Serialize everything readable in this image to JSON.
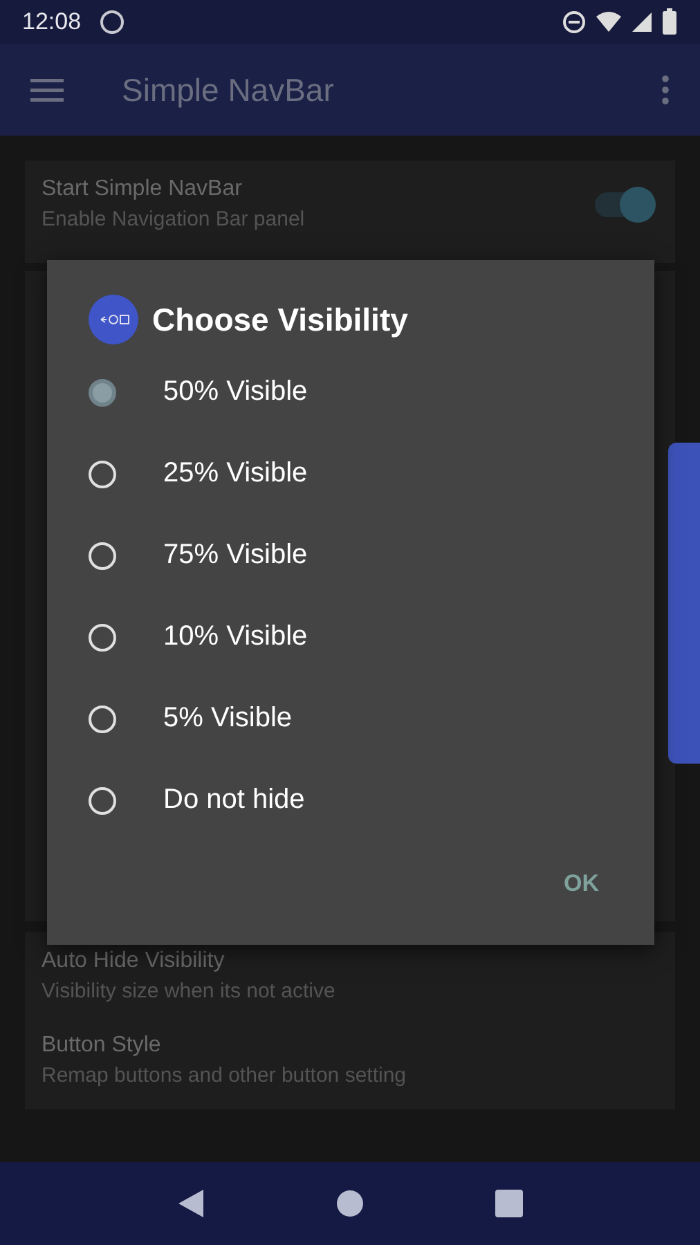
{
  "status_bar": {
    "time": "12:08"
  },
  "app_bar": {
    "title": "Simple NavBar"
  },
  "settings": [
    {
      "title": "Start Simple NavBar",
      "summary": "Enable Navigation Bar panel",
      "kind": "switch",
      "on": true
    },
    {
      "title": "Auto Hide Visibility",
      "summary": "Visibility size when its not active",
      "kind": "plain"
    },
    {
      "title": "Button Style",
      "summary": "Remap buttons and other button setting",
      "kind": "plain"
    }
  ],
  "dialog": {
    "title": "Choose Visibility",
    "options": [
      {
        "label": "50% Visible",
        "selected": true
      },
      {
        "label": "25% Visible",
        "selected": false
      },
      {
        "label": "75% Visible",
        "selected": false
      },
      {
        "label": "10% Visible",
        "selected": false
      },
      {
        "label": "5% Visible",
        "selected": false
      },
      {
        "label": "Do not hide",
        "selected": false
      }
    ],
    "buttons": [
      "OK"
    ]
  }
}
